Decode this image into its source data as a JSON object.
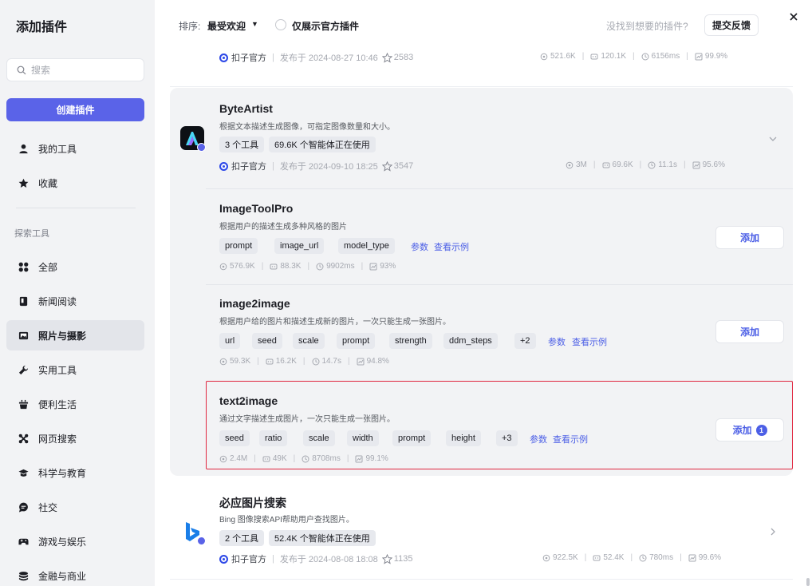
{
  "sidebar": {
    "title": "添加插件",
    "search_placeholder": "搜索",
    "create_label": "创建插件",
    "top_items": [
      {
        "label": "我的工具",
        "icon": "user-icon"
      },
      {
        "label": "收藏",
        "icon": "star-icon"
      }
    ],
    "section_label": "探索工具",
    "categories": [
      {
        "label": "全部",
        "icon": "grid-icon",
        "active": false
      },
      {
        "label": "新闻阅读",
        "icon": "book-icon",
        "active": false
      },
      {
        "label": "照片与摄影",
        "icon": "photo-icon",
        "active": true
      },
      {
        "label": "实用工具",
        "icon": "wrench-icon",
        "active": false
      },
      {
        "label": "便利生活",
        "icon": "cup-icon",
        "active": false
      },
      {
        "label": "网页搜索",
        "icon": "web-icon",
        "active": false
      },
      {
        "label": "科学与教育",
        "icon": "graduation-cap-icon",
        "active": false
      },
      {
        "label": "社交",
        "icon": "chat-icon",
        "active": false
      },
      {
        "label": "游戏与娱乐",
        "icon": "gamepad-icon",
        "active": false
      },
      {
        "label": "金融与商业",
        "icon": "coins-icon",
        "active": false
      }
    ]
  },
  "header": {
    "sort_label": "排序:",
    "sort_value": "最受欢迎",
    "official_only_label": "仅展示官方插件",
    "official_only_checked": false,
    "not_found_text": "没找到想要的插件?",
    "feedback_label": "提交反馈"
  },
  "plugins": [
    {
      "org": "扣子官方",
      "published": "发布于 2024-08-27 10:46",
      "stars": "2583",
      "stats": {
        "calls": "521.6K",
        "bots": "120.1K",
        "latency": "6156ms",
        "success": "99.9%"
      }
    },
    {
      "name": "ByteArtist",
      "desc": "根据文本描述生成图像，可指定图像数量和大小。",
      "tags": [
        "3 个工具",
        "69.6K 个智能体正在使用"
      ],
      "org": "扣子官方",
      "published": "发布于 2024-09-10 18:25",
      "stars": "3547",
      "stats": {
        "calls": "3M",
        "bots": "69.6K",
        "latency": "11.1s",
        "success": "95.6%"
      },
      "tools": [
        {
          "name": "ImageToolPro",
          "desc": "根据用户的描述生成多种风格的图片",
          "params": [
            "prompt",
            "image_url",
            "model_type"
          ],
          "params_link": "参数",
          "example_link": "查看示例",
          "stats": {
            "calls": "576.9K",
            "bots": "88.3K",
            "latency": "9902ms",
            "success": "93%"
          },
          "add_label": "添加"
        },
        {
          "name": "image2image",
          "desc": "根据用户给的图片和描述生成新的图片，一次只能生成一张图片。",
          "params": [
            "url",
            "seed",
            "scale",
            "prompt",
            "strength",
            "ddm_steps",
            "+2"
          ],
          "params_link": "参数",
          "example_link": "查看示例",
          "stats": {
            "calls": "59.3K",
            "bots": "16.2K",
            "latency": "14.7s",
            "success": "94.8%"
          },
          "add_label": "添加"
        },
        {
          "name": "text2image",
          "desc": "通过文字描述生成图片，一次只能生成一张图片。",
          "params": [
            "seed",
            "ratio",
            "scale",
            "width",
            "prompt",
            "height",
            "+3"
          ],
          "params_link": "参数",
          "example_link": "查看示例",
          "stats": {
            "calls": "2.4M",
            "bots": "49K",
            "latency": "8708ms",
            "success": "99.1%"
          },
          "add_label": "添加",
          "added_count": "1"
        }
      ]
    },
    {
      "name": "必应图片搜索",
      "desc": "Bing 图像搜索API帮助用户查找图片。",
      "tags": [
        "2 个工具",
        "52.4K 个智能体正在使用"
      ],
      "org": "扣子官方",
      "published": "发布于 2024-08-08 18:08",
      "stars": "1135",
      "stats": {
        "calls": "922.5K",
        "bots": "52.4K",
        "latency": "780ms",
        "success": "99.6%"
      }
    }
  ],
  "colors": {
    "accent": "#5a63e8",
    "link": "#4c5fe6",
    "highlight": "#e0263f"
  }
}
